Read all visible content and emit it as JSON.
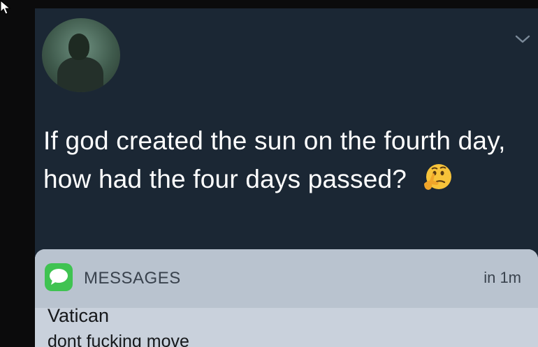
{
  "tweet": {
    "text": "If god created the sun on the fourth day, how had the four days passed?",
    "emoji": "thinking-face-icon"
  },
  "notification": {
    "app_name": "MESSAGES",
    "time": "in 1m",
    "sender": "Vatican",
    "message": "dont fucking move"
  },
  "colors": {
    "tweet_background": "#1b2734",
    "notification_background": "#c9d1dc",
    "messages_green": "#3fc351"
  }
}
